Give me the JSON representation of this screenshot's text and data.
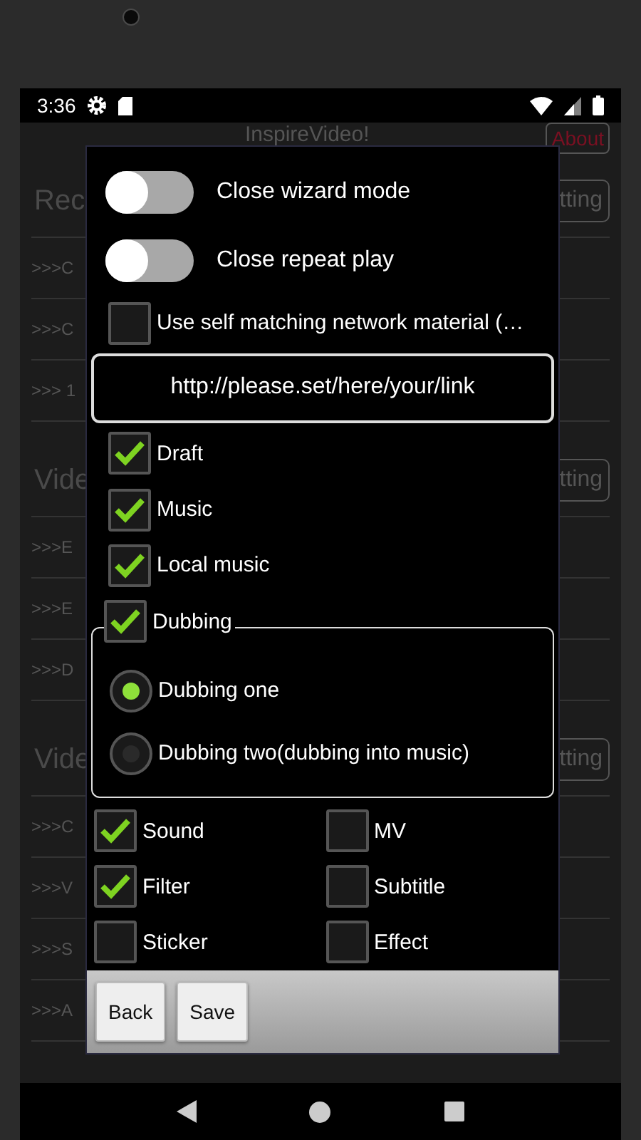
{
  "status_bar": {
    "time": "3:36"
  },
  "background": {
    "title": "InspireVideo!",
    "about_button": "About",
    "sections": [
      {
        "title": "Rec",
        "button": "tting",
        "items": [
          ">>>C",
          ">>>C",
          ">>> 1"
        ]
      },
      {
        "title": "Vide",
        "button": "tting",
        "items": [
          ">>>E",
          ">>>E",
          ">>>D"
        ]
      },
      {
        "title": "Vide",
        "button": "tting",
        "items": [
          ">>>C",
          ">>>V",
          ">>>S",
          ">>>A"
        ]
      }
    ]
  },
  "dialog": {
    "toggles": [
      {
        "label": "Close wizard mode",
        "on": false
      },
      {
        "label": "Close repeat play",
        "on": false
      }
    ],
    "network_material": {
      "label": "Use self matching network material (…",
      "checked": false
    },
    "link_field": {
      "value": "http://please.set/here/your/link"
    },
    "options": [
      {
        "label": "Draft",
        "checked": true
      },
      {
        "label": "Music",
        "checked": true
      },
      {
        "label": "Local music",
        "checked": true
      }
    ],
    "dubbing": {
      "label": "Dubbing",
      "checked": true
    },
    "dubbing_modes": [
      {
        "label": "Dubbing one",
        "selected": true
      },
      {
        "label": "Dubbing two(dubbing into music)",
        "selected": false
      }
    ],
    "features": [
      {
        "label": "Sound",
        "checked": true
      },
      {
        "label": "MV",
        "checked": false
      },
      {
        "label": "Filter",
        "checked": true
      },
      {
        "label": "Subtitle",
        "checked": false
      },
      {
        "label": "Sticker",
        "checked": false
      },
      {
        "label": "Effect",
        "checked": false
      }
    ],
    "buttons": [
      "Back",
      "Save"
    ]
  }
}
